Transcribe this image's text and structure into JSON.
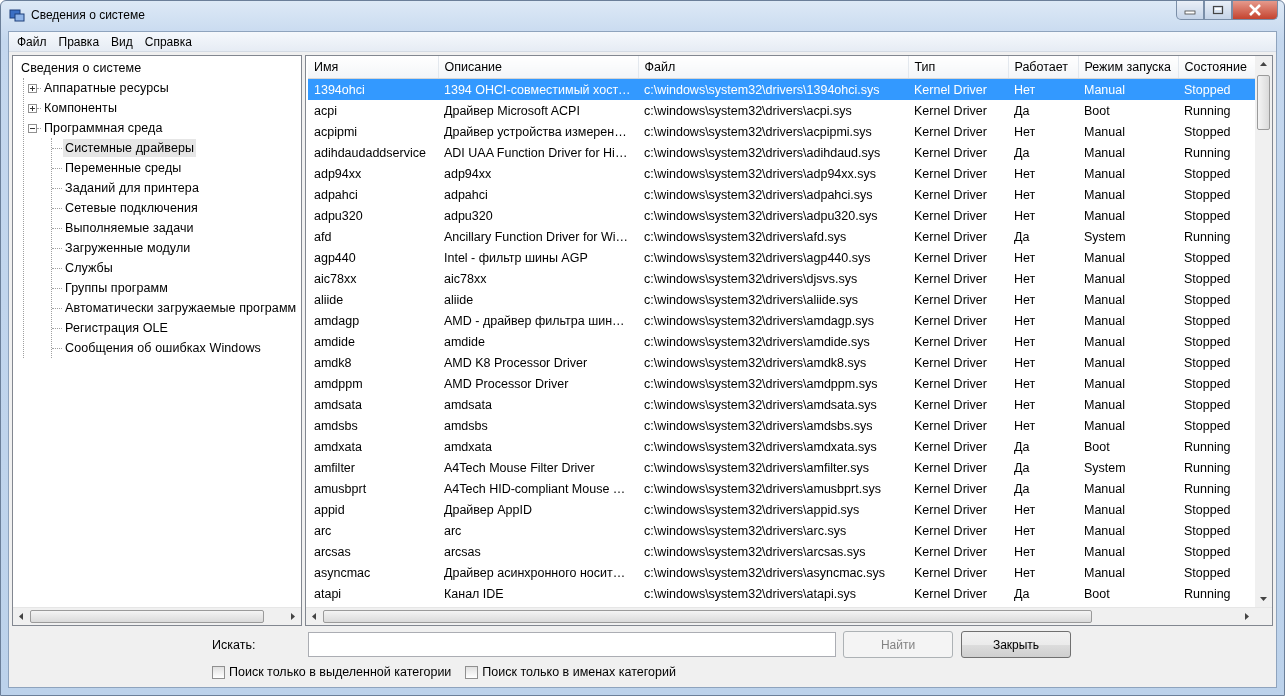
{
  "window": {
    "title": "Сведения о системе"
  },
  "menu": [
    "Файл",
    "Правка",
    "Вид",
    "Справка"
  ],
  "tree": {
    "label": "Сведения о системе",
    "selected": false,
    "children": [
      {
        "label": "Аппаратные ресурсы",
        "expanded": false,
        "selected": false
      },
      {
        "label": "Компоненты",
        "expanded": false,
        "selected": false
      },
      {
        "label": "Программная среда",
        "expanded": true,
        "selected": false,
        "children": [
          {
            "label": "Системные драйверы",
            "selected": true
          },
          {
            "label": "Переменные среды",
            "selected": false
          },
          {
            "label": "Заданий для принтера",
            "selected": false
          },
          {
            "label": "Сетевые подключения",
            "selected": false
          },
          {
            "label": "Выполняемые задачи",
            "selected": false
          },
          {
            "label": "Загруженные модули",
            "selected": false
          },
          {
            "label": "Службы",
            "selected": false
          },
          {
            "label": "Группы программ",
            "selected": false
          },
          {
            "label": "Автоматически загружаемые программ",
            "selected": false
          },
          {
            "label": "Регистрация OLE",
            "selected": false
          },
          {
            "label": "Сообщения об ошибках Windows",
            "selected": false
          }
        ]
      }
    ]
  },
  "table": {
    "columns": [
      "Имя",
      "Описание",
      "Файл",
      "Тип",
      "Работает",
      "Режим запуска",
      "Состояние"
    ],
    "rows": [
      {
        "selected": true,
        "cells": [
          "1394ohci",
          "1394 OHCI-совместимый хост…",
          "c:\\windows\\system32\\drivers\\1394ohci.sys",
          "Kernel Driver",
          "Нет",
          "Manual",
          "Stopped"
        ]
      },
      {
        "selected": false,
        "cells": [
          "acpi",
          "Драйвер Microsoft ACPI",
          "c:\\windows\\system32\\drivers\\acpi.sys",
          "Kernel Driver",
          "Да",
          "Boot",
          "Running"
        ]
      },
      {
        "selected": false,
        "cells": [
          "acpipmi",
          "Драйвер устройства измерен…",
          "c:\\windows\\system32\\drivers\\acpipmi.sys",
          "Kernel Driver",
          "Нет",
          "Manual",
          "Stopped"
        ]
      },
      {
        "selected": false,
        "cells": [
          "adihdaudaddservice",
          "ADI UAA Function Driver for Hi…",
          "c:\\windows\\system32\\drivers\\adihdaud.sys",
          "Kernel Driver",
          "Да",
          "Manual",
          "Running"
        ]
      },
      {
        "selected": false,
        "cells": [
          "adp94xx",
          "adp94xx",
          "c:\\windows\\system32\\drivers\\adp94xx.sys",
          "Kernel Driver",
          "Нет",
          "Manual",
          "Stopped"
        ]
      },
      {
        "selected": false,
        "cells": [
          "adpahci",
          "adpahci",
          "c:\\windows\\system32\\drivers\\adpahci.sys",
          "Kernel Driver",
          "Нет",
          "Manual",
          "Stopped"
        ]
      },
      {
        "selected": false,
        "cells": [
          "adpu320",
          "adpu320",
          "c:\\windows\\system32\\drivers\\adpu320.sys",
          "Kernel Driver",
          "Нет",
          "Manual",
          "Stopped"
        ]
      },
      {
        "selected": false,
        "cells": [
          "afd",
          "Ancillary Function Driver for Wi…",
          "c:\\windows\\system32\\drivers\\afd.sys",
          "Kernel Driver",
          "Да",
          "System",
          "Running"
        ]
      },
      {
        "selected": false,
        "cells": [
          "agp440",
          "Intel - фильтр шины AGP",
          "c:\\windows\\system32\\drivers\\agp440.sys",
          "Kernel Driver",
          "Нет",
          "Manual",
          "Stopped"
        ]
      },
      {
        "selected": false,
        "cells": [
          "aic78xx",
          "aic78xx",
          "c:\\windows\\system32\\drivers\\djsvs.sys",
          "Kernel Driver",
          "Нет",
          "Manual",
          "Stopped"
        ]
      },
      {
        "selected": false,
        "cells": [
          "aliide",
          "aliide",
          "c:\\windows\\system32\\drivers\\aliide.sys",
          "Kernel Driver",
          "Нет",
          "Manual",
          "Stopped"
        ]
      },
      {
        "selected": false,
        "cells": [
          "amdagp",
          "AMD - драйвер фильтра шин…",
          "c:\\windows\\system32\\drivers\\amdagp.sys",
          "Kernel Driver",
          "Нет",
          "Manual",
          "Stopped"
        ]
      },
      {
        "selected": false,
        "cells": [
          "amdide",
          "amdide",
          "c:\\windows\\system32\\drivers\\amdide.sys",
          "Kernel Driver",
          "Нет",
          "Manual",
          "Stopped"
        ]
      },
      {
        "selected": false,
        "cells": [
          "amdk8",
          "AMD K8 Processor Driver",
          "c:\\windows\\system32\\drivers\\amdk8.sys",
          "Kernel Driver",
          "Нет",
          "Manual",
          "Stopped"
        ]
      },
      {
        "selected": false,
        "cells": [
          "amdppm",
          "AMD Processor Driver",
          "c:\\windows\\system32\\drivers\\amdppm.sys",
          "Kernel Driver",
          "Нет",
          "Manual",
          "Stopped"
        ]
      },
      {
        "selected": false,
        "cells": [
          "amdsata",
          "amdsata",
          "c:\\windows\\system32\\drivers\\amdsata.sys",
          "Kernel Driver",
          "Нет",
          "Manual",
          "Stopped"
        ]
      },
      {
        "selected": false,
        "cells": [
          "amdsbs",
          "amdsbs",
          "c:\\windows\\system32\\drivers\\amdsbs.sys",
          "Kernel Driver",
          "Нет",
          "Manual",
          "Stopped"
        ]
      },
      {
        "selected": false,
        "cells": [
          "amdxata",
          "amdxata",
          "c:\\windows\\system32\\drivers\\amdxata.sys",
          "Kernel Driver",
          "Да",
          "Boot",
          "Running"
        ]
      },
      {
        "selected": false,
        "cells": [
          "amfilter",
          "A4Tech Mouse Filter Driver",
          "c:\\windows\\system32\\drivers\\amfilter.sys",
          "Kernel Driver",
          "Да",
          "System",
          "Running"
        ]
      },
      {
        "selected": false,
        "cells": [
          "amusbprt",
          "A4Tech HID-compliant Mouse …",
          "c:\\windows\\system32\\drivers\\amusbprt.sys",
          "Kernel Driver",
          "Да",
          "Manual",
          "Running"
        ]
      },
      {
        "selected": false,
        "cells": [
          "appid",
          "Драйвер AppID",
          "c:\\windows\\system32\\drivers\\appid.sys",
          "Kernel Driver",
          "Нет",
          "Manual",
          "Stopped"
        ]
      },
      {
        "selected": false,
        "cells": [
          "arc",
          "arc",
          "c:\\windows\\system32\\drivers\\arc.sys",
          "Kernel Driver",
          "Нет",
          "Manual",
          "Stopped"
        ]
      },
      {
        "selected": false,
        "cells": [
          "arcsas",
          "arcsas",
          "c:\\windows\\system32\\drivers\\arcsas.sys",
          "Kernel Driver",
          "Нет",
          "Manual",
          "Stopped"
        ]
      },
      {
        "selected": false,
        "cells": [
          "asyncmac",
          "Драйвер асинхронного носит…",
          "c:\\windows\\system32\\drivers\\asyncmac.sys",
          "Kernel Driver",
          "Нет",
          "Manual",
          "Stopped"
        ]
      },
      {
        "selected": false,
        "cells": [
          "atapi",
          "Канал IDE",
          "c:\\windows\\system32\\drivers\\atapi.sys",
          "Kernel Driver",
          "Да",
          "Boot",
          "Running"
        ]
      }
    ]
  },
  "search": {
    "label": "Искать:"
  },
  "buttons": [
    {
      "label": "Найти",
      "disabled": true
    },
    {
      "label": "Закрыть",
      "disabled": false
    }
  ],
  "checkboxes": [
    {
      "label": "Поиск только в выделенной категории",
      "checked": false
    },
    {
      "label": "Поиск только в именах категорий",
      "checked": false
    }
  ]
}
